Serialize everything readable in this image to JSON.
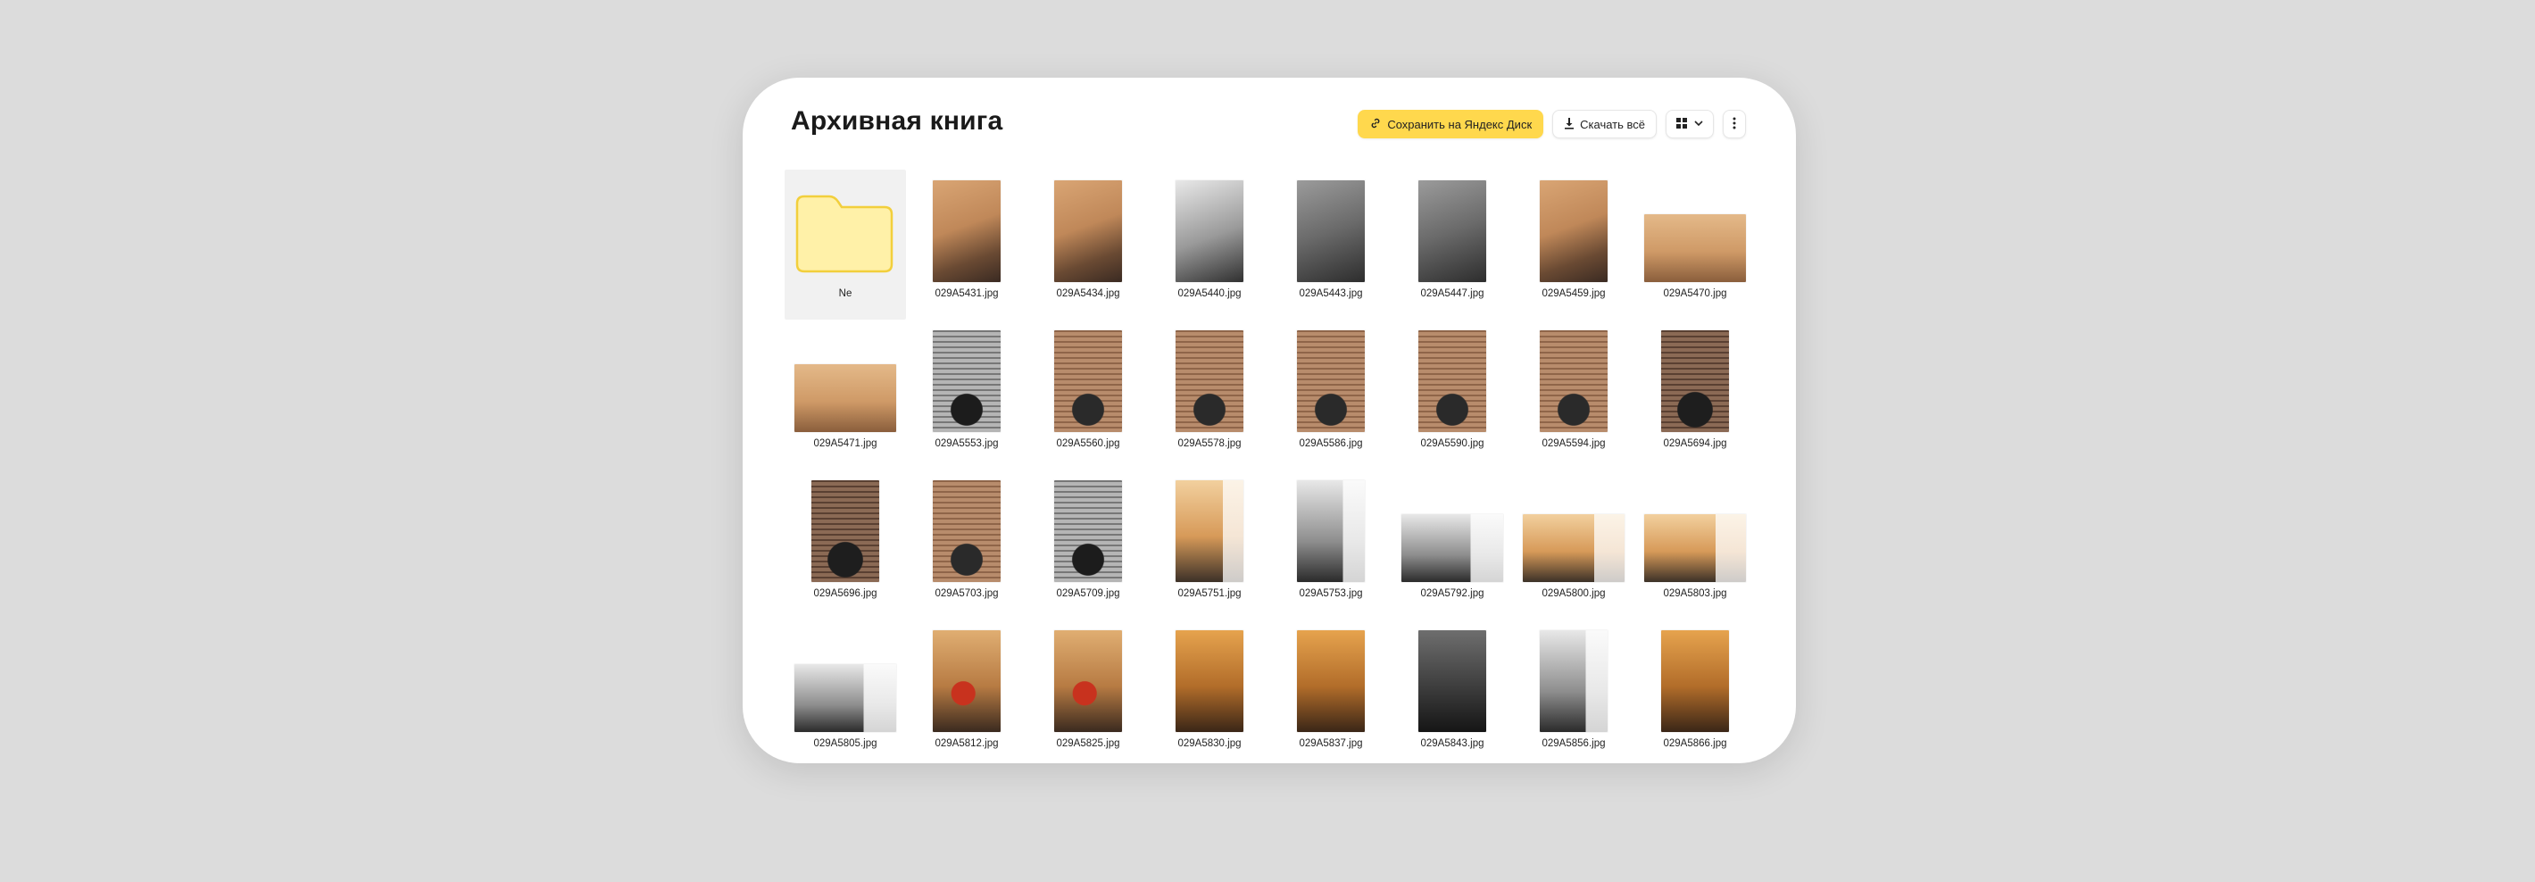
{
  "album": {
    "title": "Архивная книга"
  },
  "toolbar": {
    "save_label": "Сохранить на Яндекс Диск",
    "download_label": "Скачать всё",
    "save_color": "#ffd84d"
  },
  "grid": {
    "items": [
      {
        "type": "folder",
        "label": "Ne"
      },
      {
        "type": "photo",
        "label": "029A5431.jpg",
        "orientation": "portrait",
        "tone": "warm"
      },
      {
        "type": "photo",
        "label": "029A5434.jpg",
        "orientation": "portrait",
        "tone": "warm"
      },
      {
        "type": "photo",
        "label": "029A5440.jpg",
        "orientation": "portrait",
        "tone": "bwlight"
      },
      {
        "type": "photo",
        "label": "029A5443.jpg",
        "orientation": "portrait",
        "tone": "bw"
      },
      {
        "type": "photo",
        "label": "029A5447.jpg",
        "orientation": "portrait",
        "tone": "bw"
      },
      {
        "type": "photo",
        "label": "029A5459.jpg",
        "orientation": "portrait",
        "tone": "warm"
      },
      {
        "type": "photo",
        "label": "029A5470.jpg",
        "orientation": "landscape",
        "tone": "warm2"
      },
      {
        "type": "photo",
        "label": "029A5471.jpg",
        "orientation": "landscape",
        "tone": "warm2"
      },
      {
        "type": "photo",
        "label": "029A5553.jpg",
        "orientation": "portrait",
        "tone": "brickbw"
      },
      {
        "type": "photo",
        "label": "029A5560.jpg",
        "orientation": "portrait",
        "tone": "brick"
      },
      {
        "type": "photo",
        "label": "029A5578.jpg",
        "orientation": "portrait",
        "tone": "brick"
      },
      {
        "type": "photo",
        "label": "029A5586.jpg",
        "orientation": "portrait",
        "tone": "brick"
      },
      {
        "type": "photo",
        "label": "029A5590.jpg",
        "orientation": "portrait",
        "tone": "brick"
      },
      {
        "type": "photo",
        "label": "029A5594.jpg",
        "orientation": "portrait",
        "tone": "brick"
      },
      {
        "type": "photo",
        "label": "029A5694.jpg",
        "orientation": "portrait",
        "tone": "brickdark"
      },
      {
        "type": "photo",
        "label": "029A5696.jpg",
        "orientation": "portrait",
        "tone": "brickdark"
      },
      {
        "type": "photo",
        "label": "029A5703.jpg",
        "orientation": "portrait",
        "tone": "brick"
      },
      {
        "type": "photo",
        "label": "029A5709.jpg",
        "orientation": "portrait",
        "tone": "brickbw"
      },
      {
        "type": "photo",
        "label": "029A5751.jpg",
        "orientation": "portrait",
        "tone": "window"
      },
      {
        "type": "photo",
        "label": "029A5753.jpg",
        "orientation": "portrait",
        "tone": "windowbw"
      },
      {
        "type": "photo",
        "label": "029A5792.jpg",
        "orientation": "landscape",
        "tone": "windowbw"
      },
      {
        "type": "photo",
        "label": "029A5800.jpg",
        "orientation": "landscape",
        "tone": "window"
      },
      {
        "type": "photo",
        "label": "029A5803.jpg",
        "orientation": "landscape",
        "tone": "window"
      },
      {
        "type": "photo",
        "label": "029A5805.jpg",
        "orientation": "landscape",
        "tone": "windowbw"
      },
      {
        "type": "photo",
        "label": "029A5812.jpg",
        "orientation": "portrait",
        "tone": "red"
      },
      {
        "type": "photo",
        "label": "029A5825.jpg",
        "orientation": "portrait",
        "tone": "red"
      },
      {
        "type": "photo",
        "label": "029A5830.jpg",
        "orientation": "portrait",
        "tone": "amber"
      },
      {
        "type": "photo",
        "label": "029A5837.jpg",
        "orientation": "portrait",
        "tone": "amber"
      },
      {
        "type": "photo",
        "label": "029A5843.jpg",
        "orientation": "portrait",
        "tone": "darkbw"
      },
      {
        "type": "photo",
        "label": "029A5856.jpg",
        "orientation": "portrait",
        "tone": "windowbw"
      },
      {
        "type": "photo",
        "label": "029A5866.jpg",
        "orientation": "portrait",
        "tone": "amber"
      }
    ]
  }
}
